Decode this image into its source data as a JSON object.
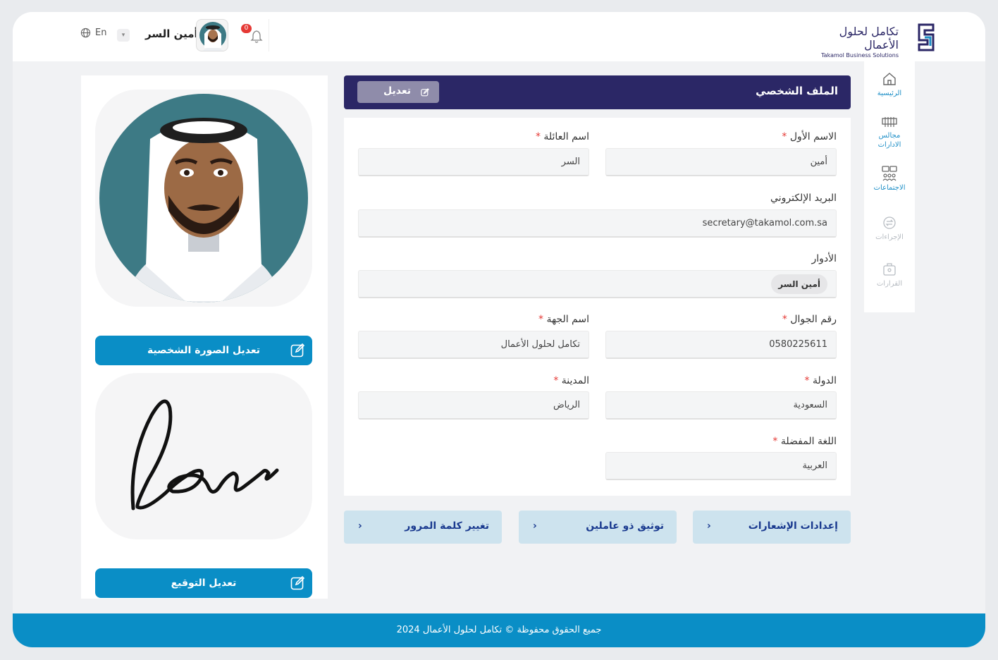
{
  "header": {
    "logo_ar": "تكامل لحلول الأعمال",
    "logo_en": "Takamol Business Solutions",
    "user_name": "أمين السر",
    "language": "En",
    "notification_count": "0"
  },
  "sidebar": {
    "items": [
      {
        "label": "الرئيسية",
        "icon": "home-icon",
        "active": true
      },
      {
        "label": "مجالس الادارات",
        "icon": "boards-icon",
        "active": true
      },
      {
        "label": "الاجتماعات",
        "icon": "meetings-icon",
        "active": true
      },
      {
        "label": "الإجراءات",
        "icon": "actions-icon",
        "active": false
      },
      {
        "label": "القرارات",
        "icon": "decisions-icon",
        "active": false
      }
    ]
  },
  "left": {
    "edit_photo_label": "تعديل الصورة الشخصية",
    "edit_signature_label": "تعديل التوقيع"
  },
  "profile": {
    "title": "الملف الشخصي",
    "edit_label": "تعديل",
    "fields": {
      "first_name": {
        "label": "الاسم الأول",
        "value": "أمين"
      },
      "family_name": {
        "label": "اسم العائلة",
        "value": "السر"
      },
      "email": {
        "label": "البريد الإلكتروني",
        "value": "secretary@takamol.com.sa"
      },
      "roles": {
        "label": "الأدوار",
        "value": "أمين السر"
      },
      "mobile": {
        "label": "رقم الجوال",
        "value": "0580225611"
      },
      "entity": {
        "label": "اسم الجهة",
        "value": "تكامل لحلول الأعمال"
      },
      "country": {
        "label": "الدولة",
        "value": "السعودية"
      },
      "city": {
        "label": "المدينة",
        "value": "الرياض"
      },
      "language": {
        "label": "اللغة المفضلة",
        "value": "العربية"
      }
    }
  },
  "actions": {
    "notifications_settings": "إعدادات الإشعارات",
    "two_factor": "توثيق ذو عاملين",
    "change_password": "تغيير كلمة المرور"
  },
  "footer": {
    "copyright": "جميع الحقوق محفوظة © تكامل لحلول الأعمال 2024"
  },
  "colors": {
    "primary_navy": "#2b2766",
    "primary_blue": "#0a8ec6",
    "required": "#e53935",
    "link_button_bg": "#cde3ee"
  }
}
